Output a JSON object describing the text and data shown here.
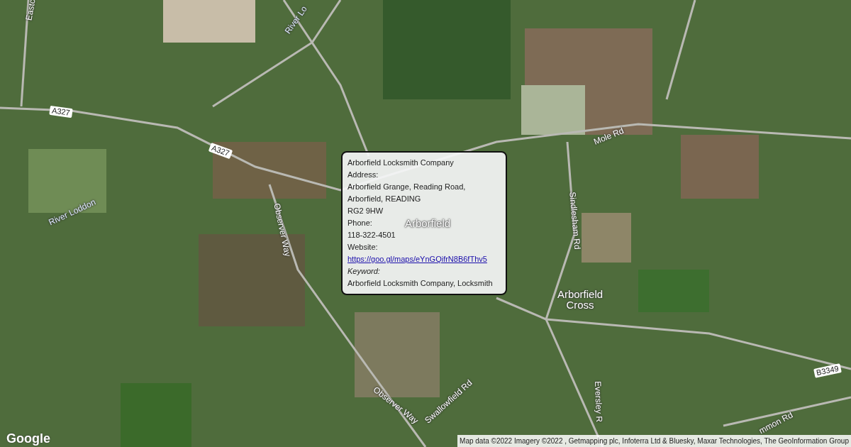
{
  "map": {
    "labels": [
      {
        "text": "Eastc",
        "kind": "road"
      },
      {
        "text": "River Lo",
        "kind": "water"
      },
      {
        "text": "A327",
        "kind": "shield"
      },
      {
        "text": "A327",
        "kind": "shield"
      },
      {
        "text": "River Loddon",
        "kind": "water"
      },
      {
        "text": "Observer Way",
        "kind": "road"
      },
      {
        "text": "Arborfield",
        "kind": "place"
      },
      {
        "text": "Mole Rd",
        "kind": "road"
      },
      {
        "text": "Sindlesham Rd",
        "kind": "road"
      },
      {
        "text": "Arborfield Cross",
        "kind": "place"
      },
      {
        "text": "Observer Way",
        "kind": "road"
      },
      {
        "text": "Swallowfield Rd",
        "kind": "road"
      },
      {
        "text": "Eversley R",
        "kind": "road"
      },
      {
        "text": "B3349",
        "kind": "shield"
      },
      {
        "text": "mmon Rd",
        "kind": "road"
      }
    ]
  },
  "info_window": {
    "lines": [
      {
        "text": "Arborfield Locksmith Company",
        "kind": "plain"
      },
      {
        "text": "Address:",
        "kind": "plain"
      },
      {
        "text": "Arborfield Grange, Reading Road,",
        "kind": "plain"
      },
      {
        "text": "Arborfield, READING",
        "kind": "plain"
      },
      {
        "text": "RG2 9HW",
        "kind": "plain"
      },
      {
        "text": "Phone:",
        "kind": "plain"
      },
      {
        "text": "118-322-4501",
        "kind": "plain"
      },
      {
        "text": "Website:",
        "kind": "plain"
      },
      {
        "text": "https://goo.gl/maps/eYnGQifrN8B6fThv5",
        "kind": "link"
      },
      {
        "text": "Keyword:",
        "kind": "italic"
      },
      {
        "text": "Arborfield Locksmith Company, Locksmith",
        "kind": "plain"
      }
    ]
  },
  "logo": "Google",
  "attribution": "Map data ©2022 Imagery ©2022 , Getmapping plc, Infoterra Ltd & Bluesky, Maxar Technologies, The GeoInformation Group"
}
